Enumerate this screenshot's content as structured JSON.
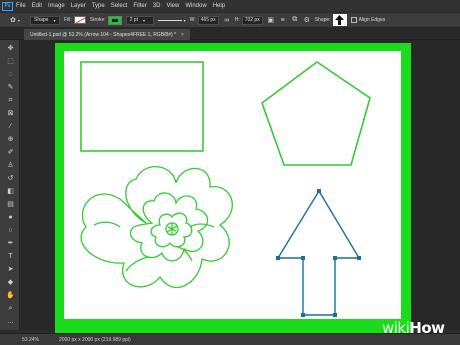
{
  "menubar": {
    "logo": "Ps",
    "items": [
      "File",
      "Edit",
      "Image",
      "Layer",
      "Type",
      "Select",
      "Filter",
      "3D",
      "View",
      "Window",
      "Help"
    ]
  },
  "options": {
    "mode": "Shape",
    "fill_label": "Fill:",
    "stroke_label": "Stroke:",
    "stroke_color": "#1ac636",
    "stroke_width": "2 pt",
    "w_label": "W:",
    "w_value": "465 px",
    "h_label": "H:",
    "h_value": "702 px",
    "shape_label": "Shape:",
    "align_edges_label": "Align Edges"
  },
  "tab": {
    "title": "Untitled-1.psd @ 53.2% (Arrow 104 - Shapes4FREE 1, RGB/8#) *",
    "close": "×"
  },
  "status": {
    "zoom": "53.24%",
    "doc_size": "2000 px x 2000 px (219.989 ppi)"
  },
  "canvas": {
    "border_color": "#1bdc1b",
    "shape_color": "#33cc33",
    "path_color": "#1a6fa0"
  },
  "watermark": {
    "wiki": "wiki",
    "how": "How"
  }
}
